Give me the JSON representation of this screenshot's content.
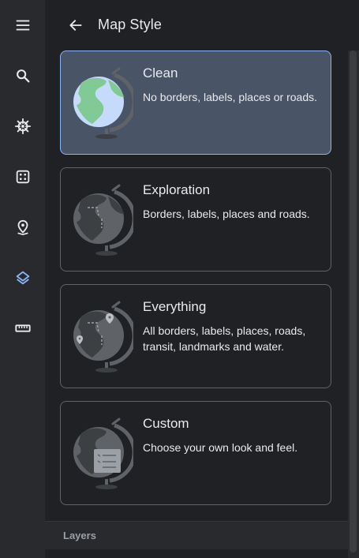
{
  "rail": {
    "items": [
      {
        "name": "menu-icon",
        "color": "#e8eaed"
      },
      {
        "name": "search-icon",
        "color": "#e8eaed"
      },
      {
        "name": "ship-wheel-icon",
        "color": "#e8eaed"
      },
      {
        "name": "dice-icon",
        "color": "#e8eaed"
      },
      {
        "name": "place-pin-icon",
        "color": "#e8eaed"
      },
      {
        "name": "layers-icon",
        "color": "#8ab4f8"
      },
      {
        "name": "ruler-icon",
        "color": "#e8eaed"
      }
    ]
  },
  "header": {
    "title": "Map Style"
  },
  "cards": [
    {
      "title": "Clean",
      "description": "No borders, labels, places or roads.",
      "selected": true
    },
    {
      "title": "Exploration",
      "description": "Borders, labels, places and roads.",
      "selected": false
    },
    {
      "title": "Everything",
      "description": "All borders, labels, places, roads, transit, landmarks and water.",
      "selected": false
    },
    {
      "title": "Custom",
      "description": "Choose your own look and feel.",
      "selected": false
    }
  ],
  "footer": {
    "layers_label": "Layers"
  },
  "colors": {
    "accent": "#8ab4f8",
    "selected_card_bg": "#4a5467",
    "panel_bg": "#202124",
    "rail_bg": "#292a2d"
  }
}
